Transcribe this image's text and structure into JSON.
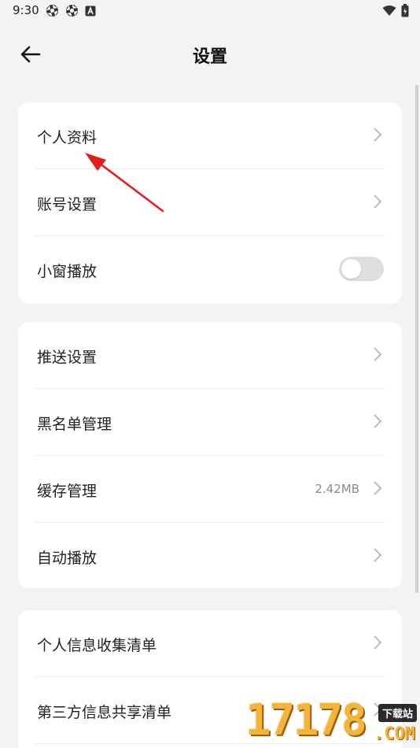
{
  "status_bar": {
    "time": "9:30"
  },
  "header": {
    "title": "设置"
  },
  "groups": [
    {
      "items": [
        {
          "label": "个人资料"
        },
        {
          "label": "账号设置"
        },
        {
          "label": "小窗播放",
          "toggle": false
        }
      ]
    },
    {
      "items": [
        {
          "label": "推送设置"
        },
        {
          "label": "黑名单管理"
        },
        {
          "label": "缓存管理",
          "value": "2.42MB"
        },
        {
          "label": "自动播放"
        }
      ]
    },
    {
      "items": [
        {
          "label": "个人信息收集清单"
        },
        {
          "label": "第三方信息共享清单"
        }
      ]
    }
  ],
  "watermark": {
    "digits": "17178",
    "tag": "下载站",
    "domain": ".COM"
  },
  "colors": {
    "background": "#f3f3f5",
    "card": "#ffffff",
    "annotation_arrow": "#e02020",
    "toggle_off": "#dedede"
  }
}
